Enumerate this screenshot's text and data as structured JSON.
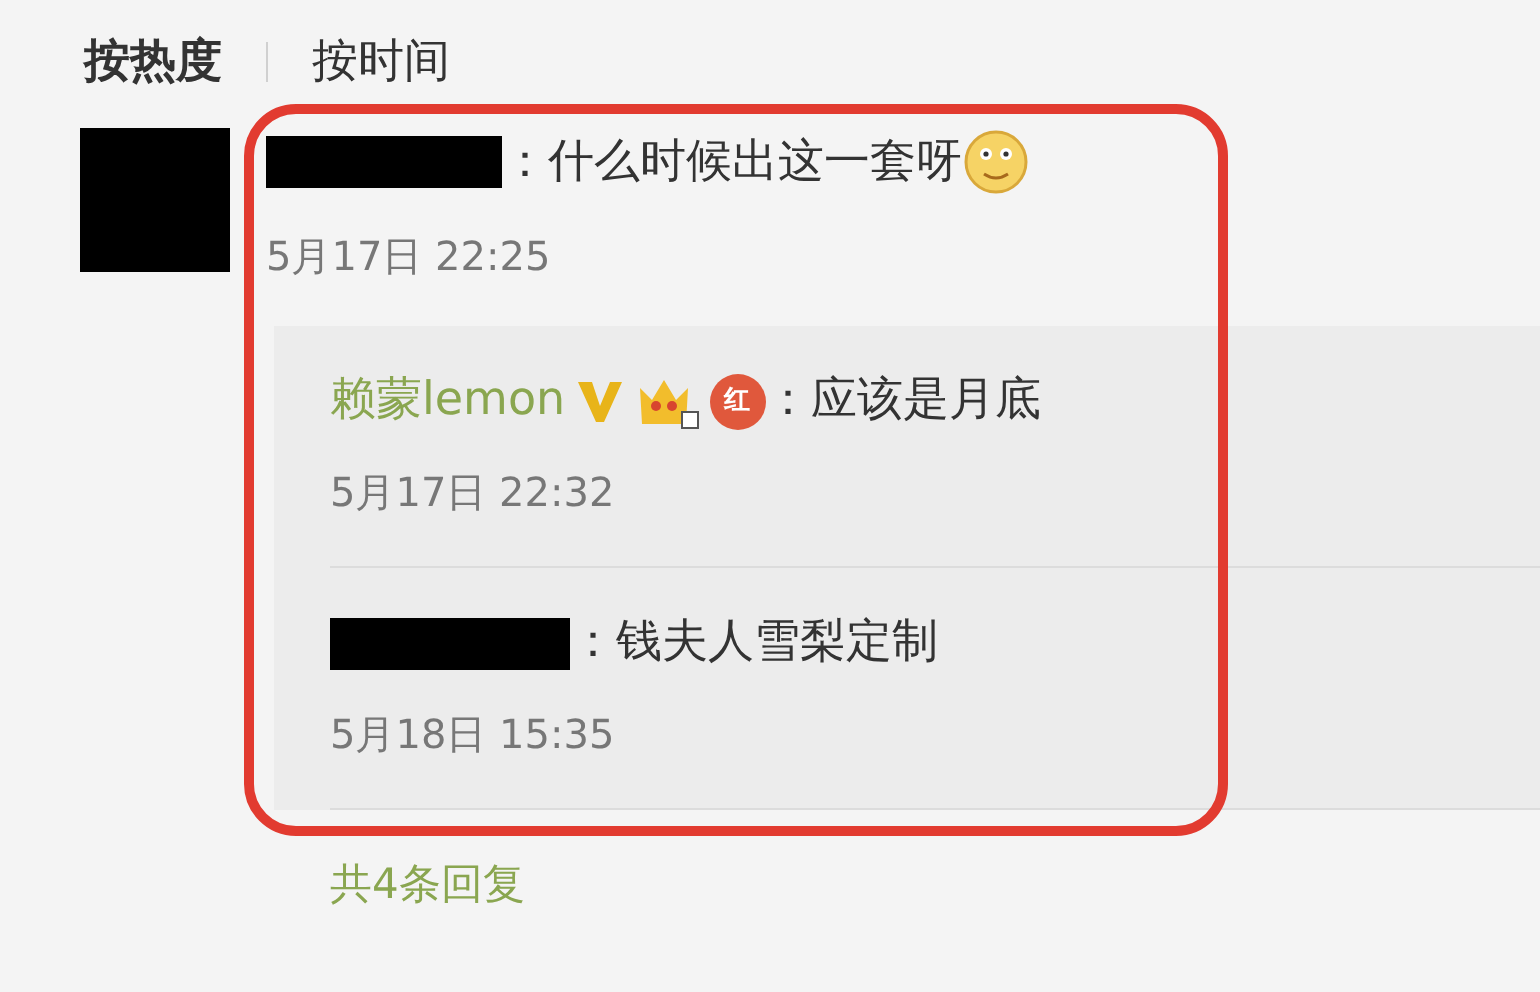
{
  "sort_tabs": [
    {
      "label": "按热度",
      "selected": true
    },
    {
      "label": "按时间",
      "selected": false
    }
  ],
  "comment": {
    "text": "：什么时候出这一套呀",
    "time": "5月17日 22:25"
  },
  "replies": [
    {
      "kind": "named",
      "name": "赖蒙lemon",
      "badge": "红",
      "text": "：应该是月底",
      "time": "5月17日 22:32"
    },
    {
      "kind": "redacted",
      "text": "：钱夫人雪梨定制",
      "time": "5月18日 15:35"
    }
  ],
  "more_replies": "共4条回复"
}
